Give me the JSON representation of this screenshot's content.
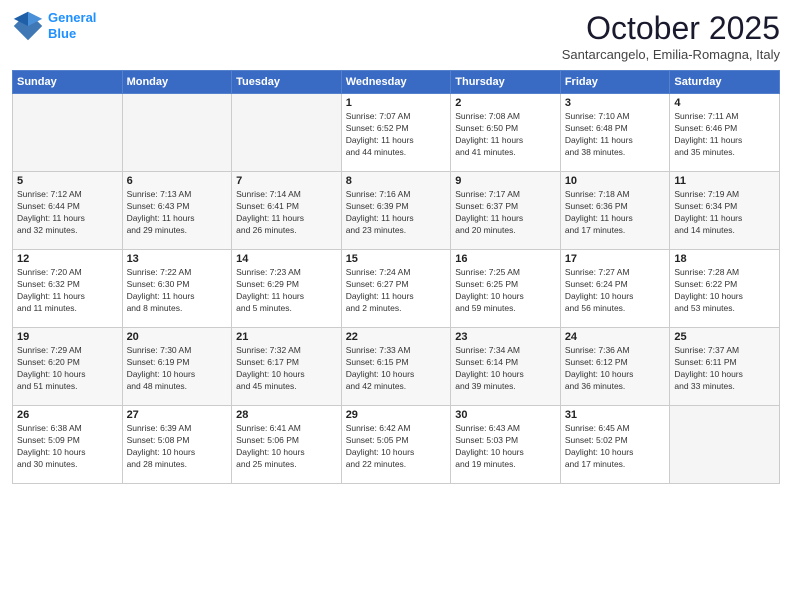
{
  "header": {
    "logo_line1": "General",
    "logo_line2": "Blue",
    "month": "October 2025",
    "location": "Santarcangelo, Emilia-Romagna, Italy"
  },
  "days_of_week": [
    "Sunday",
    "Monday",
    "Tuesday",
    "Wednesday",
    "Thursday",
    "Friday",
    "Saturday"
  ],
  "weeks": [
    [
      {
        "day": "",
        "info": "",
        "empty": true
      },
      {
        "day": "",
        "info": "",
        "empty": true
      },
      {
        "day": "",
        "info": "",
        "empty": true
      },
      {
        "day": "1",
        "info": "Sunrise: 7:07 AM\nSunset: 6:52 PM\nDaylight: 11 hours\nand 44 minutes."
      },
      {
        "day": "2",
        "info": "Sunrise: 7:08 AM\nSunset: 6:50 PM\nDaylight: 11 hours\nand 41 minutes."
      },
      {
        "day": "3",
        "info": "Sunrise: 7:10 AM\nSunset: 6:48 PM\nDaylight: 11 hours\nand 38 minutes."
      },
      {
        "day": "4",
        "info": "Sunrise: 7:11 AM\nSunset: 6:46 PM\nDaylight: 11 hours\nand 35 minutes."
      }
    ],
    [
      {
        "day": "5",
        "info": "Sunrise: 7:12 AM\nSunset: 6:44 PM\nDaylight: 11 hours\nand 32 minutes."
      },
      {
        "day": "6",
        "info": "Sunrise: 7:13 AM\nSunset: 6:43 PM\nDaylight: 11 hours\nand 29 minutes."
      },
      {
        "day": "7",
        "info": "Sunrise: 7:14 AM\nSunset: 6:41 PM\nDaylight: 11 hours\nand 26 minutes."
      },
      {
        "day": "8",
        "info": "Sunrise: 7:16 AM\nSunset: 6:39 PM\nDaylight: 11 hours\nand 23 minutes."
      },
      {
        "day": "9",
        "info": "Sunrise: 7:17 AM\nSunset: 6:37 PM\nDaylight: 11 hours\nand 20 minutes."
      },
      {
        "day": "10",
        "info": "Sunrise: 7:18 AM\nSunset: 6:36 PM\nDaylight: 11 hours\nand 17 minutes."
      },
      {
        "day": "11",
        "info": "Sunrise: 7:19 AM\nSunset: 6:34 PM\nDaylight: 11 hours\nand 14 minutes."
      }
    ],
    [
      {
        "day": "12",
        "info": "Sunrise: 7:20 AM\nSunset: 6:32 PM\nDaylight: 11 hours\nand 11 minutes."
      },
      {
        "day": "13",
        "info": "Sunrise: 7:22 AM\nSunset: 6:30 PM\nDaylight: 11 hours\nand 8 minutes."
      },
      {
        "day": "14",
        "info": "Sunrise: 7:23 AM\nSunset: 6:29 PM\nDaylight: 11 hours\nand 5 minutes."
      },
      {
        "day": "15",
        "info": "Sunrise: 7:24 AM\nSunset: 6:27 PM\nDaylight: 11 hours\nand 2 minutes."
      },
      {
        "day": "16",
        "info": "Sunrise: 7:25 AM\nSunset: 6:25 PM\nDaylight: 10 hours\nand 59 minutes."
      },
      {
        "day": "17",
        "info": "Sunrise: 7:27 AM\nSunset: 6:24 PM\nDaylight: 10 hours\nand 56 minutes."
      },
      {
        "day": "18",
        "info": "Sunrise: 7:28 AM\nSunset: 6:22 PM\nDaylight: 10 hours\nand 53 minutes."
      }
    ],
    [
      {
        "day": "19",
        "info": "Sunrise: 7:29 AM\nSunset: 6:20 PM\nDaylight: 10 hours\nand 51 minutes."
      },
      {
        "day": "20",
        "info": "Sunrise: 7:30 AM\nSunset: 6:19 PM\nDaylight: 10 hours\nand 48 minutes."
      },
      {
        "day": "21",
        "info": "Sunrise: 7:32 AM\nSunset: 6:17 PM\nDaylight: 10 hours\nand 45 minutes."
      },
      {
        "day": "22",
        "info": "Sunrise: 7:33 AM\nSunset: 6:15 PM\nDaylight: 10 hours\nand 42 minutes."
      },
      {
        "day": "23",
        "info": "Sunrise: 7:34 AM\nSunset: 6:14 PM\nDaylight: 10 hours\nand 39 minutes."
      },
      {
        "day": "24",
        "info": "Sunrise: 7:36 AM\nSunset: 6:12 PM\nDaylight: 10 hours\nand 36 minutes."
      },
      {
        "day": "25",
        "info": "Sunrise: 7:37 AM\nSunset: 6:11 PM\nDaylight: 10 hours\nand 33 minutes."
      }
    ],
    [
      {
        "day": "26",
        "info": "Sunrise: 6:38 AM\nSunset: 5:09 PM\nDaylight: 10 hours\nand 30 minutes."
      },
      {
        "day": "27",
        "info": "Sunrise: 6:39 AM\nSunset: 5:08 PM\nDaylight: 10 hours\nand 28 minutes."
      },
      {
        "day": "28",
        "info": "Sunrise: 6:41 AM\nSunset: 5:06 PM\nDaylight: 10 hours\nand 25 minutes."
      },
      {
        "day": "29",
        "info": "Sunrise: 6:42 AM\nSunset: 5:05 PM\nDaylight: 10 hours\nand 22 minutes."
      },
      {
        "day": "30",
        "info": "Sunrise: 6:43 AM\nSunset: 5:03 PM\nDaylight: 10 hours\nand 19 minutes."
      },
      {
        "day": "31",
        "info": "Sunrise: 6:45 AM\nSunset: 5:02 PM\nDaylight: 10 hours\nand 17 minutes."
      },
      {
        "day": "",
        "info": "",
        "empty": true
      }
    ]
  ]
}
